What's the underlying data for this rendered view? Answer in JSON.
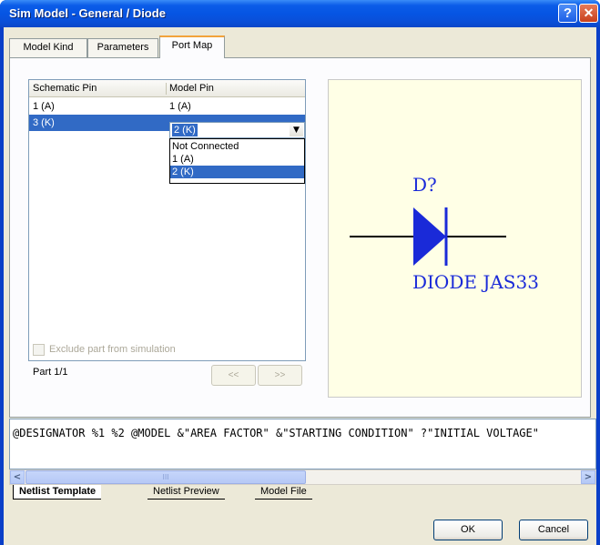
{
  "window": {
    "title": "Sim Model - General / Diode",
    "help_label": "?",
    "close_label": "✕"
  },
  "tabs": [
    {
      "label": "Model Kind"
    },
    {
      "label": "Parameters"
    },
    {
      "label": "Port Map"
    }
  ],
  "pin_table": {
    "headers": [
      "Schematic Pin",
      "Model Pin"
    ],
    "rows": [
      {
        "schematic_pin": "1 (A)",
        "model_pin": "1 (A)"
      },
      {
        "schematic_pin": "3 (K)",
        "model_pin": "2 (K)"
      }
    ]
  },
  "model_pin_dropdown": {
    "value": "2 (K)",
    "options": [
      "Not Connected",
      "1 (A)",
      "2 (K)"
    ],
    "selected_index": 2
  },
  "symbol_preview": {
    "designator": "D?",
    "comment": "DIODE JAS33",
    "color": "#1a2ad8"
  },
  "exclude_checkbox": {
    "label": "Exclude part from simulation",
    "checked": false,
    "enabled": false
  },
  "part_label": "Part 1/1",
  "part_nav": {
    "prev_label": "<<",
    "next_label": ">>"
  },
  "netlist_template": "@DESIGNATOR %1 %2 @MODEL &\"AREA FACTOR\" &\"STARTING CONDITION\" ?\"INITIAL VOLTAGE\"",
  "scrollbar": {
    "left_label": "<",
    "right_label": ">",
    "grip_label": "III"
  },
  "bottom_tabs": [
    {
      "label": "Netlist Template"
    },
    {
      "label": "Netlist Preview"
    },
    {
      "label": "Model File"
    }
  ],
  "buttons": {
    "ok": "OK",
    "cancel": "Cancel"
  },
  "colors": {
    "title_bar": "#0655e3",
    "selection": "#316ac5",
    "dialog_bg": "#ece9d8",
    "preview_bg": "#ffffe6"
  }
}
